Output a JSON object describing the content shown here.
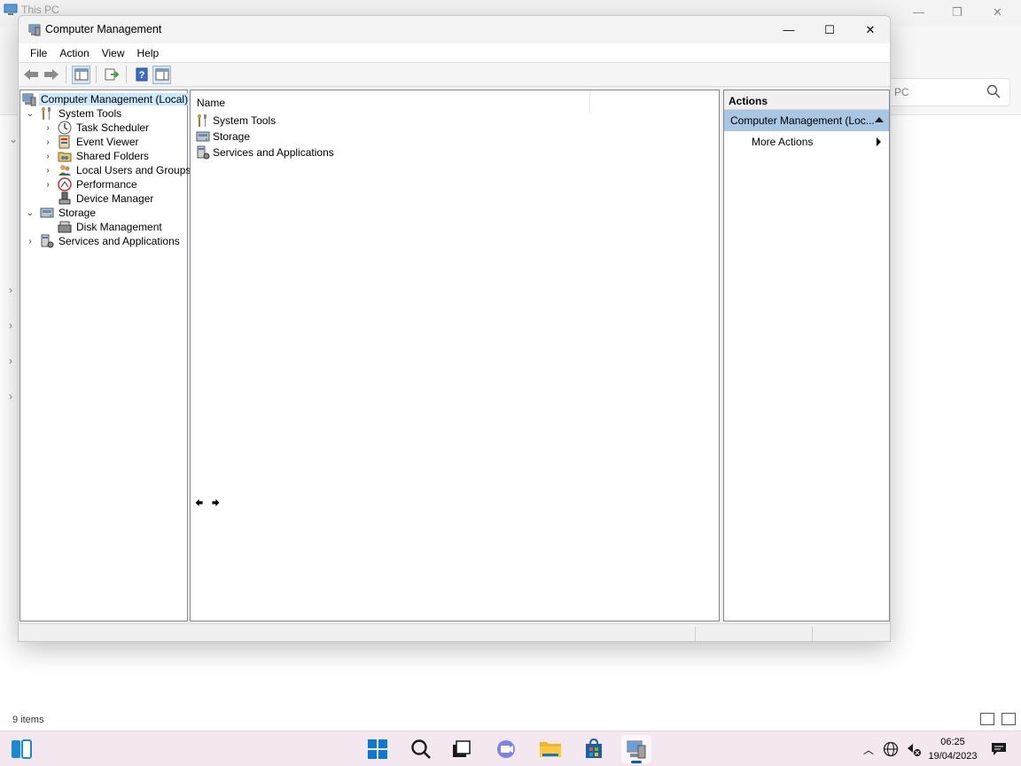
{
  "background_window": {
    "title": "This PC",
    "search_placeholder": "PC",
    "status_items": "9 items"
  },
  "window": {
    "title": "Computer Management",
    "minimize_glyph": "—",
    "maximize_glyph": "☐",
    "close_glyph": "✕"
  },
  "menu": {
    "items": [
      "File",
      "Action",
      "View",
      "Help"
    ]
  },
  "tree": {
    "root": "Computer Management (Local)",
    "system_tools": "System Tools",
    "task_scheduler": "Task Scheduler",
    "event_viewer": "Event Viewer",
    "shared_folders": "Shared Folders",
    "local_users": "Local Users and Groups",
    "performance": "Performance",
    "device_manager": "Device Manager",
    "storage": "Storage",
    "disk_management": "Disk Management",
    "services": "Services and Applications"
  },
  "content": {
    "column_name": "Name",
    "rows": [
      "System Tools",
      "Storage",
      "Services and Applications"
    ]
  },
  "actions": {
    "header": "Actions",
    "group": "Computer Management (Loc...",
    "more_actions": "More Actions"
  },
  "taskbar": {
    "time": "06:25",
    "date": "19/04/2023"
  },
  "colors": {
    "selection": "#cce8ff",
    "actions_group": "#a9c6e2",
    "taskbar_bg": "#f3e8f0"
  }
}
